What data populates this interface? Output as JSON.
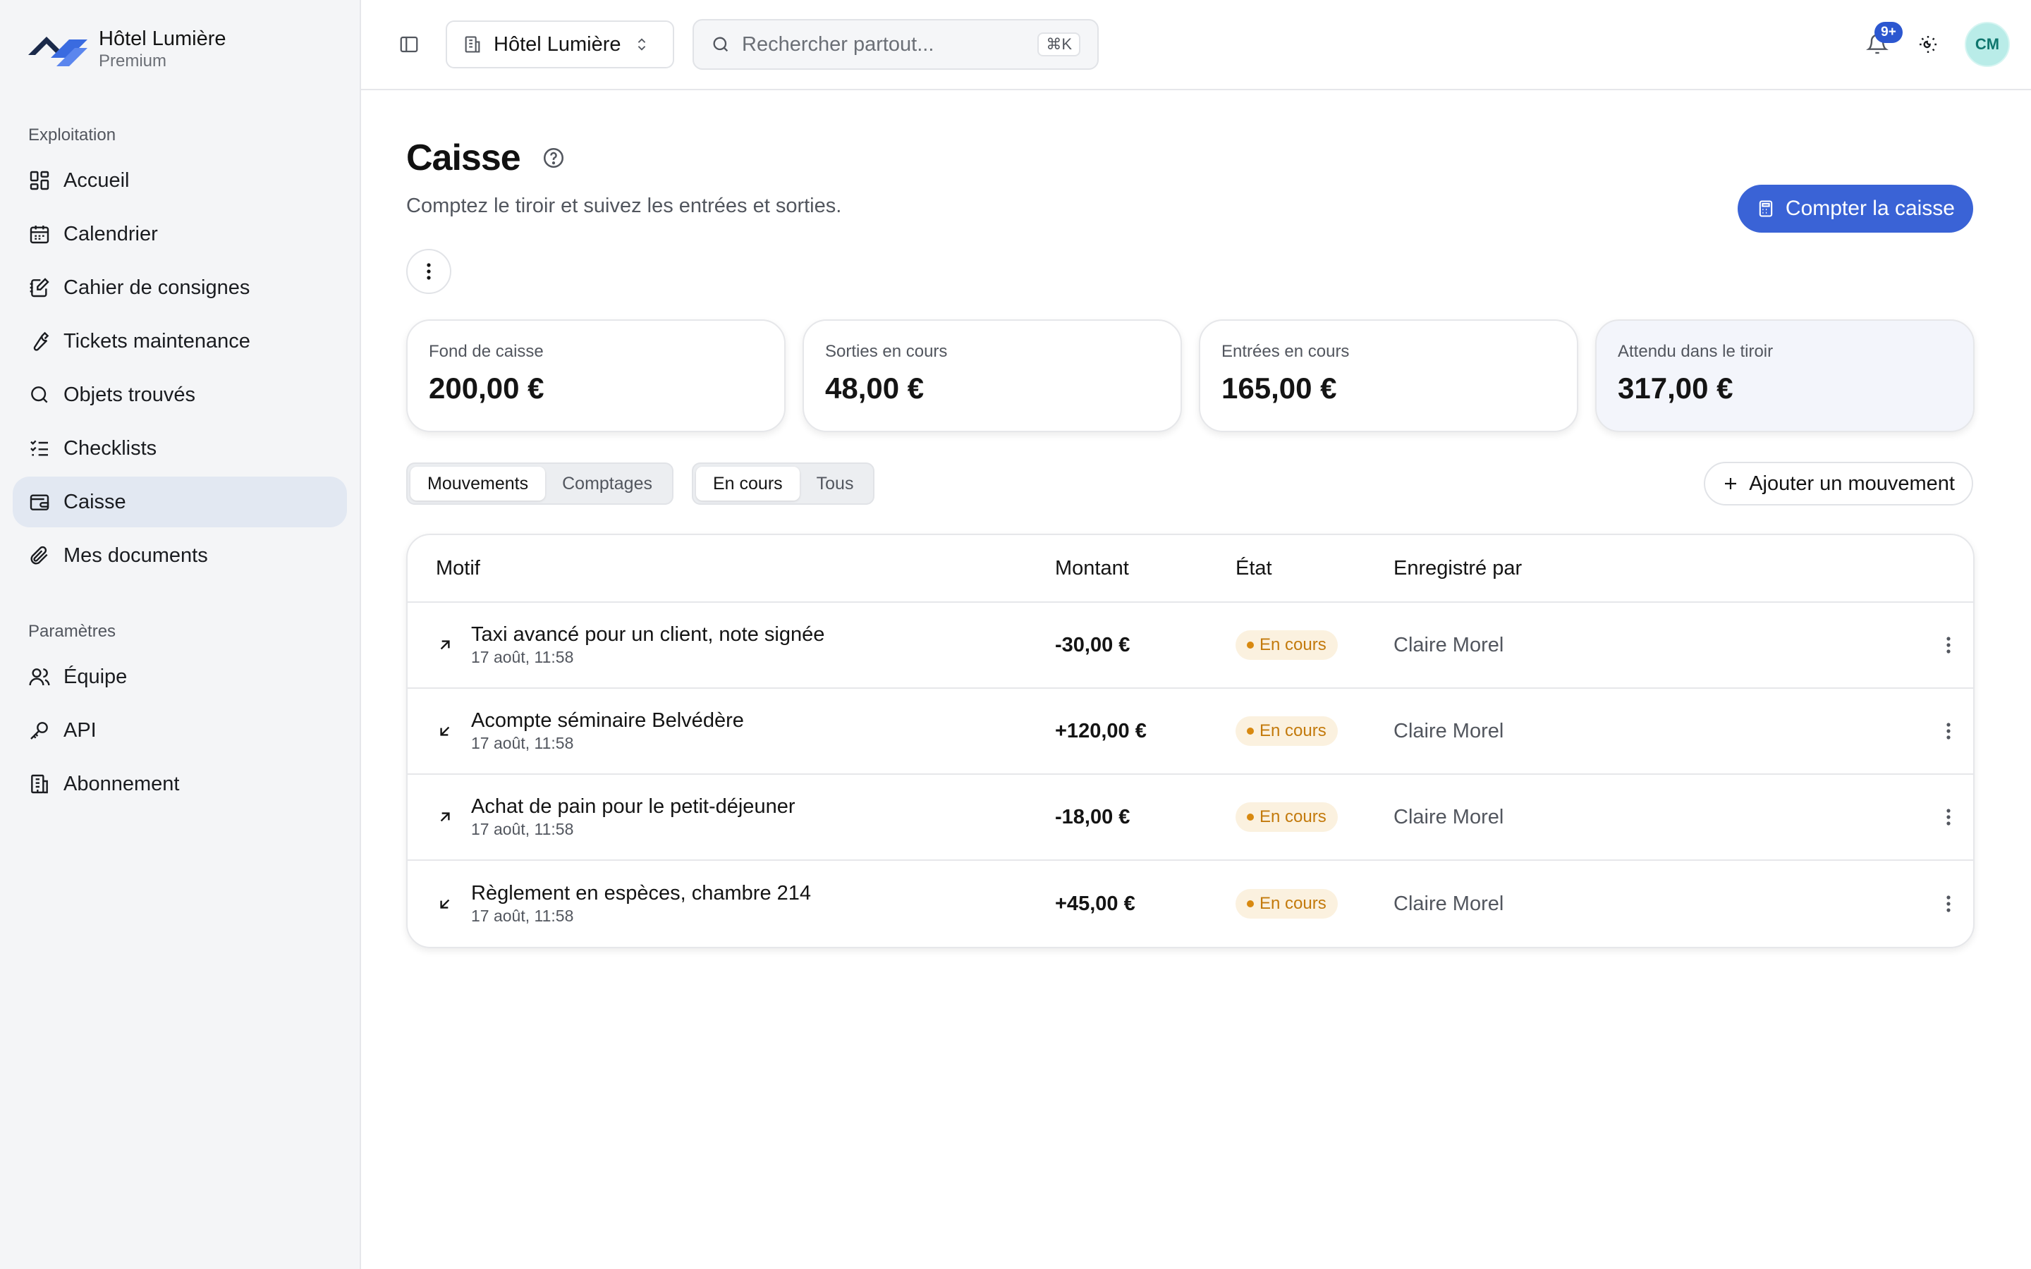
{
  "brand": {
    "name": "Hôtel Lumière",
    "plan": "Premium"
  },
  "sidebar": {
    "section1": "Exploitation",
    "items1": [
      {
        "label": "Accueil",
        "icon": "dashboard-icon"
      },
      {
        "label": "Calendrier",
        "icon": "calendar-icon"
      },
      {
        "label": "Cahier de consignes",
        "icon": "notebook-icon"
      },
      {
        "label": "Tickets maintenance",
        "icon": "wrench-icon"
      },
      {
        "label": "Objets trouvés",
        "icon": "search-icon"
      },
      {
        "label": "Checklists",
        "icon": "checklist-icon"
      },
      {
        "label": "Caisse",
        "icon": "wallet-icon",
        "active": true
      },
      {
        "label": "Mes documents",
        "icon": "paperclip-icon"
      }
    ],
    "section2": "Paramètres",
    "items2": [
      {
        "label": "Équipe",
        "icon": "users-icon"
      },
      {
        "label": "API",
        "icon": "key-icon"
      },
      {
        "label": "Abonnement",
        "icon": "building-icon"
      }
    ]
  },
  "topbar": {
    "hotel_select": "Hôtel Lumière",
    "search_placeholder": "Rechercher partout...",
    "search_shortcut": "⌘K",
    "notifications_badge": "9+",
    "avatar_initials": "CM"
  },
  "page": {
    "title": "Caisse",
    "subtitle": "Comptez le tiroir et suivez les entrées et sorties.",
    "primary_action": "Compter la caisse"
  },
  "cards": [
    {
      "label": "Fond de caisse",
      "value": "200,00 €"
    },
    {
      "label": "Sorties en cours",
      "value": "48,00 €"
    },
    {
      "label": "Entrées en cours",
      "value": "165,00 €"
    },
    {
      "label": "Attendu dans le tiroir",
      "value": "317,00 €"
    }
  ],
  "tabs": {
    "view": [
      "Mouvements",
      "Comptages"
    ],
    "filter": [
      "En cours",
      "Tous"
    ]
  },
  "add_action": "Ajouter un mouvement",
  "table": {
    "headers": {
      "motif": "Motif",
      "amount": "Montant",
      "state": "État",
      "by": "Enregistré par"
    },
    "rows": [
      {
        "direction": "out",
        "motif": "Taxi avancé pour un client, note signée",
        "date": "17 août, 11:58",
        "amount": "-30,00 €",
        "state": "En cours",
        "by": "Claire Morel"
      },
      {
        "direction": "in",
        "motif": "Acompte séminaire Belvédère",
        "date": "17 août, 11:58",
        "amount": "+120,00 €",
        "state": "En cours",
        "by": "Claire Morel"
      },
      {
        "direction": "out",
        "motif": "Achat de pain pour le petit-déjeuner",
        "date": "17 août, 11:58",
        "amount": "-18,00 €",
        "state": "En cours",
        "by": "Claire Morel"
      },
      {
        "direction": "in",
        "motif": "Règlement en espèces, chambre 214",
        "date": "17 août, 11:58",
        "amount": "+45,00 €",
        "state": "En cours",
        "by": "Claire Morel"
      }
    ]
  },
  "colors": {
    "accent": "#3a63d6",
    "active_nav": "#e2e8f2",
    "badge_text": "#c37a0c",
    "badge_bg": "#fbf1df"
  }
}
